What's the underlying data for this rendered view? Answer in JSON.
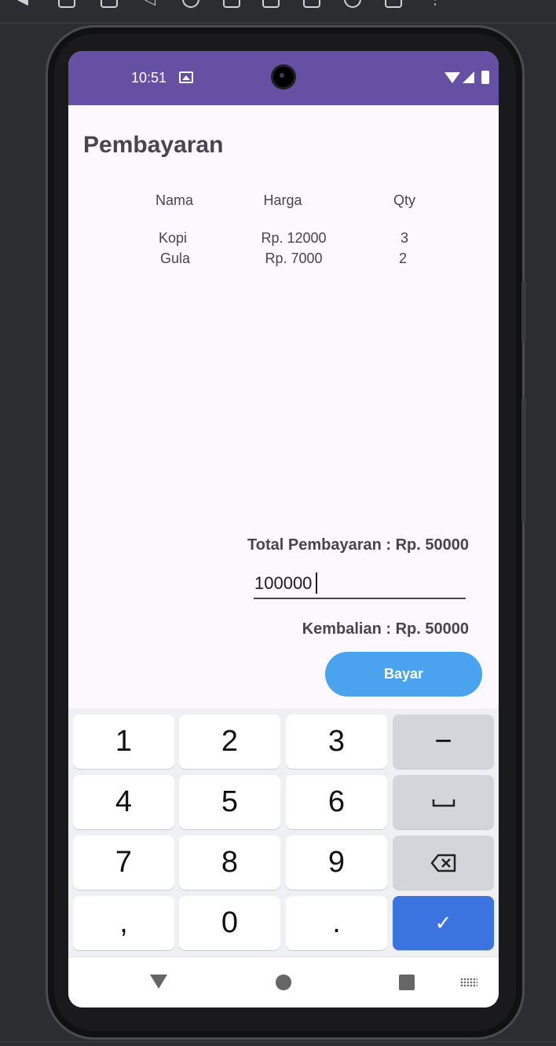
{
  "status_bar": {
    "time": "10:51",
    "icons": [
      "image-icon",
      "wifi-icon",
      "signal-icon",
      "battery-icon"
    ],
    "color": "#6750a4"
  },
  "page": {
    "title": "Pembayaran"
  },
  "table": {
    "headers": [
      "Nama",
      "Harga",
      "Qty"
    ],
    "rows": [
      {
        "nama": "Kopi",
        "harga": "Rp. 12000",
        "qty": "3"
      },
      {
        "nama": "Gula",
        "harga": "Rp. 7000",
        "qty": "2"
      }
    ]
  },
  "summary": {
    "total": "Total Pembayaran : Rp. 50000",
    "payment_value": "100000",
    "change": "Kembalian : Rp. 50000"
  },
  "actions": {
    "pay_label": "Bayar",
    "pay_color": "#4aa3ee"
  },
  "keyboard": {
    "keys": [
      "1",
      "2",
      "3",
      "−",
      "4",
      "5",
      "6",
      "",
      "7",
      "8",
      "9",
      "",
      ",",
      "0",
      ".",
      "✓"
    ],
    "enter_color": "#3b73e0"
  },
  "nav_bar": {
    "icons": [
      "back-icon",
      "home-icon",
      "recents-icon",
      "keyboard-switch-icon"
    ]
  }
}
